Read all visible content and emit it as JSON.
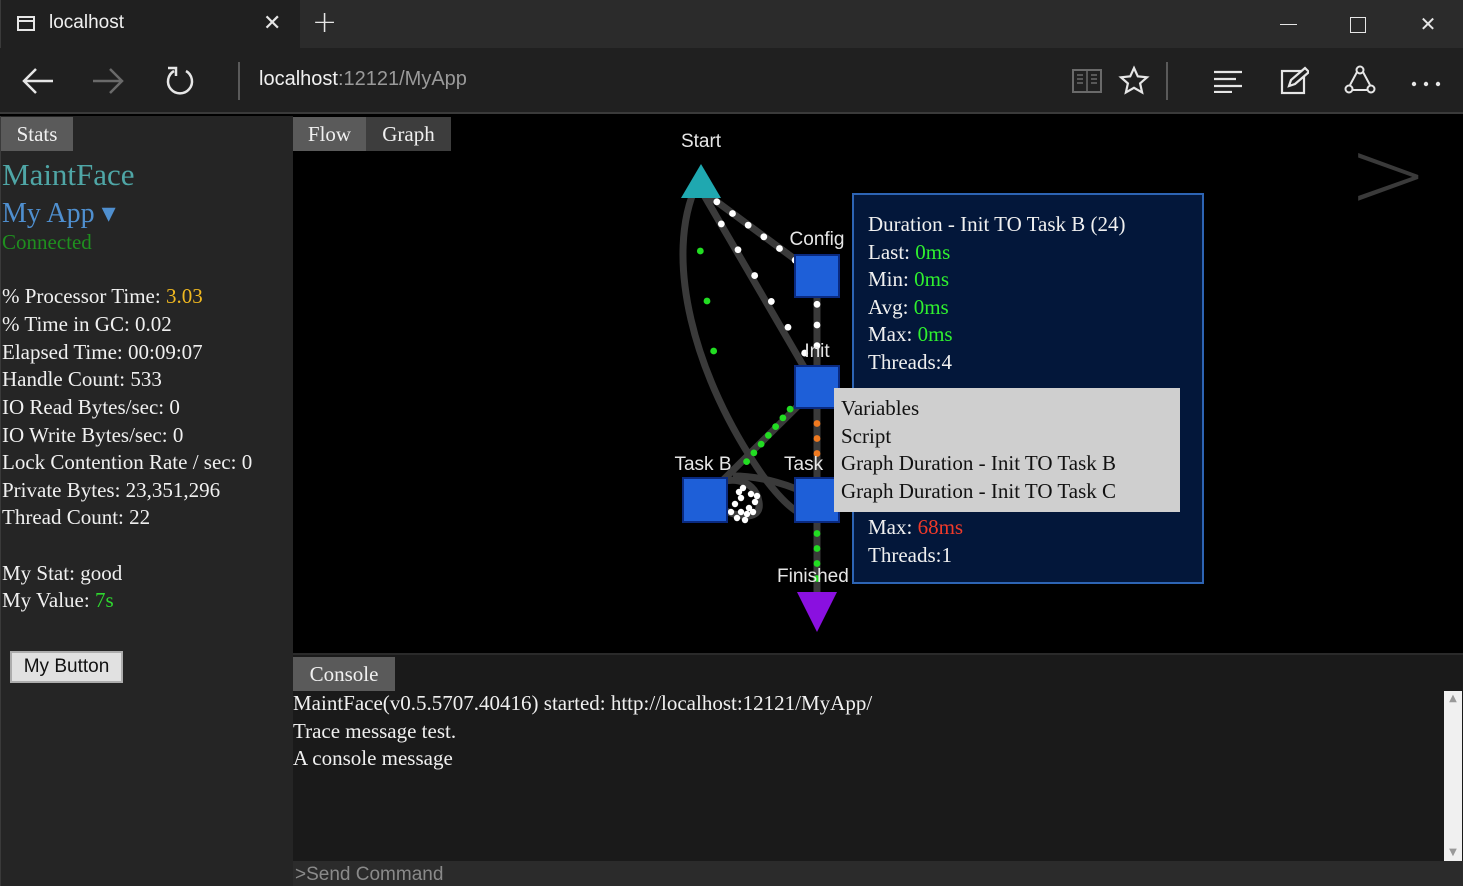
{
  "browser": {
    "tab_title": "localhost",
    "tab_close": "✕",
    "new_tab": "+",
    "win_close": "✕",
    "address_host": "localhost",
    "address_rest": ":12121/MyApp",
    "icons": [
      "tab-page-icon",
      "back-arrow-icon",
      "forward-arrow-icon",
      "refresh-icon",
      "reading-view-icon",
      "favorite-star-icon",
      "hub-icon",
      "web-note-icon",
      "share-icon",
      "more-icon"
    ]
  },
  "stats": {
    "tab_label": "Stats",
    "brand": "MaintFace",
    "app_name": "My App ▾",
    "status": "Connected",
    "lines": [
      {
        "label": "% Processor Time: ",
        "value": "3.03"
      },
      {
        "label": "% Time in GC: ",
        "value": "0.02"
      },
      {
        "label": "Elapsed Time: ",
        "value": "00:09:07"
      },
      {
        "label": "Handle Count: ",
        "value": "533"
      },
      {
        "label": "IO Read Bytes/sec: ",
        "value": "0"
      },
      {
        "label": "IO Write Bytes/sec: ",
        "value": "0"
      },
      {
        "label": "Lock Contention Rate / sec: ",
        "value": "0"
      },
      {
        "label": "Private Bytes: ",
        "value": "23,351,296"
      },
      {
        "label": "Thread Count: ",
        "value": "22"
      }
    ],
    "custom": [
      {
        "label": "My Stat: ",
        "value": "good"
      },
      {
        "label": "My Value: ",
        "value": "7s"
      }
    ],
    "button_label": "My Button"
  },
  "flow": {
    "tabs": [
      "Flow",
      "Graph"
    ],
    "next_label": ">",
    "nodes": {
      "start": "Start",
      "config": "Config",
      "init": "Init",
      "task_b": "Task B",
      "task_c": "Task",
      "finished": "Finished"
    },
    "colors": {
      "node": "#1e5fd8",
      "start": "#1fa8b0",
      "finished": "#8a10e0",
      "dot_white": "#ffffff",
      "dot_green": "#22dd22",
      "dot_orange": "#f07a20"
    },
    "tooltip": {
      "title": "Duration - Init TO Task B (24)",
      "last_label": "Last: ",
      "last_value": "0ms",
      "min_label": "Min: ",
      "min_value": "0ms",
      "avg_label": "Avg: ",
      "avg_value": "0ms",
      "max_label": "Max: ",
      "max_value": "0ms",
      "threads": "Threads:4",
      "max2_label": "Max: ",
      "max2_value": "68ms",
      "threads2": "Threads:1"
    },
    "context_menu": [
      "Variables",
      "Script",
      "Graph Duration - Init TO Task B",
      "Graph Duration - Init TO Task C"
    ]
  },
  "console": {
    "tab_label": "Console",
    "lines": [
      "MaintFace(v0.5.5707.40416) started: http://localhost:12121/MyApp/",
      "Trace message test.",
      "A console message"
    ],
    "placeholder": ">Send Command"
  }
}
